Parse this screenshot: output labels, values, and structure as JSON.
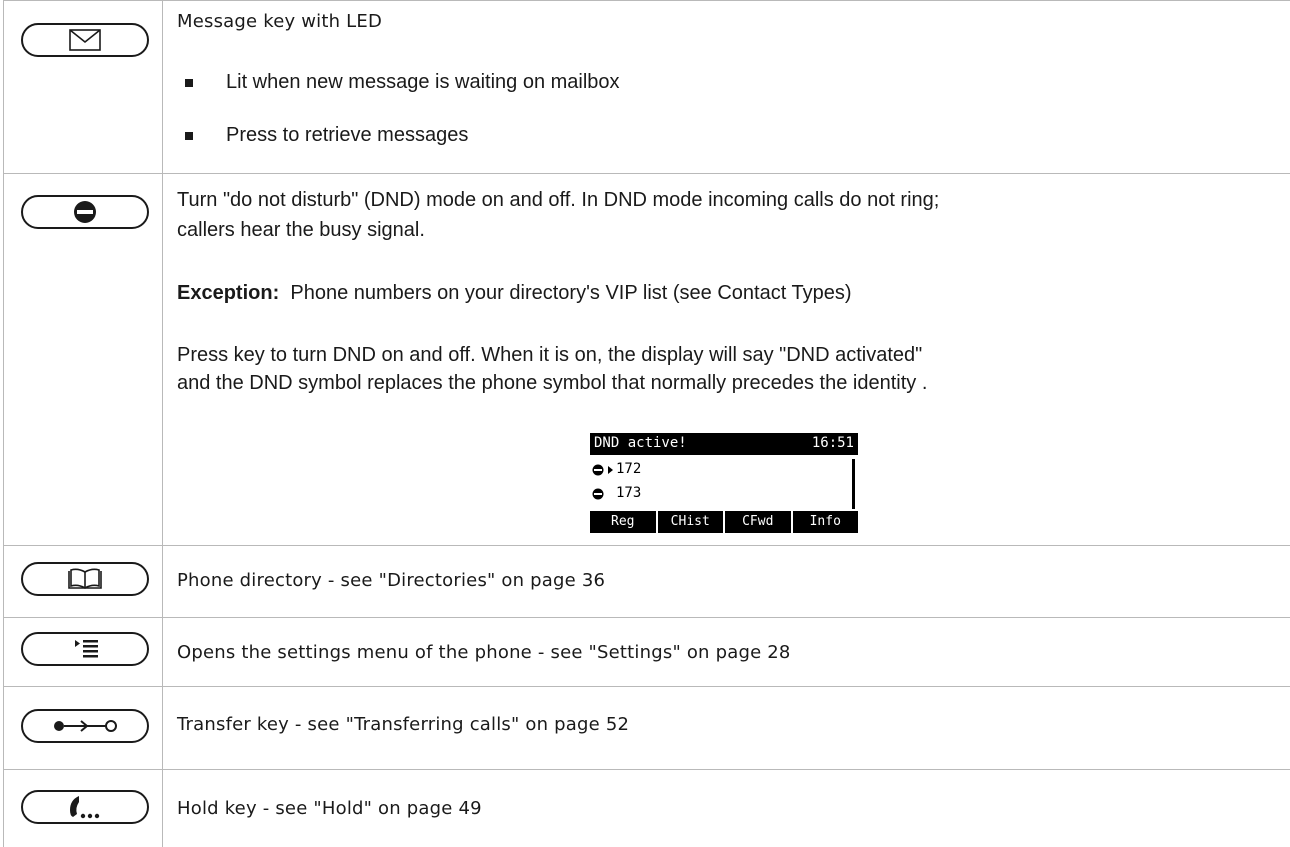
{
  "rows": {
    "message": {
      "key_icon": "envelope-icon",
      "title": "Message key with LED",
      "bullets": [
        "Lit when new message is waiting on mailbox",
        "Press to retrieve messages"
      ]
    },
    "dnd": {
      "key_icon": "dnd-icon",
      "line1": "Turn \"do not disturb\" (DND) mode on and off.  In DND mode incoming calls do not ring;",
      "line2": "callers hear the busy signal.",
      "exception_label": "Exception:",
      "exception_text": "Phone numbers on your directory's VIP list (see Contact Types)",
      "press_line1": "Press key to turn DND on and off.  When it is on, the display will say \"DND activated\"",
      "press_line2": "and the DND symbol replaces the phone symbol that normally precedes the identity .",
      "display": {
        "status": "DND active!",
        "time": "16:51",
        "lines": [
          "172",
          "173"
        ],
        "softkeys": [
          "Reg",
          "CHist",
          "CFwd",
          "Info"
        ]
      }
    },
    "directory": {
      "key_icon": "book-icon",
      "text": "Phone directory - see \"Directories\" on page 36"
    },
    "settings": {
      "key_icon": "settings-menu-icon",
      "text": "Opens the settings menu of the phone - see \"Settings\" on page 28"
    },
    "transfer": {
      "key_icon": "transfer-icon",
      "text": "Transfer key - see \"Transferring calls\" on page 52"
    },
    "hold": {
      "key_icon": "hold-icon",
      "text": "Hold key - see \"Hold\" on page 49"
    }
  }
}
